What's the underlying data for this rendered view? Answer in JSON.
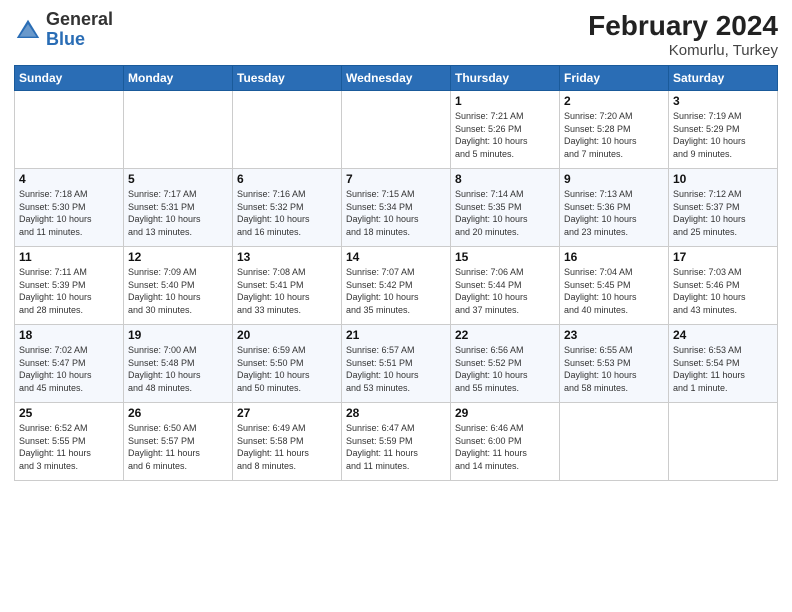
{
  "header": {
    "logo_general": "General",
    "logo_blue": "Blue",
    "title": "February 2024",
    "subtitle": "Komurlu, Turkey"
  },
  "days_of_week": [
    "Sunday",
    "Monday",
    "Tuesday",
    "Wednesday",
    "Thursday",
    "Friday",
    "Saturday"
  ],
  "weeks": [
    [
      {
        "day": "",
        "info": ""
      },
      {
        "day": "",
        "info": ""
      },
      {
        "day": "",
        "info": ""
      },
      {
        "day": "",
        "info": ""
      },
      {
        "day": "1",
        "info": "Sunrise: 7:21 AM\nSunset: 5:26 PM\nDaylight: 10 hours\nand 5 minutes."
      },
      {
        "day": "2",
        "info": "Sunrise: 7:20 AM\nSunset: 5:28 PM\nDaylight: 10 hours\nand 7 minutes."
      },
      {
        "day": "3",
        "info": "Sunrise: 7:19 AM\nSunset: 5:29 PM\nDaylight: 10 hours\nand 9 minutes."
      }
    ],
    [
      {
        "day": "4",
        "info": "Sunrise: 7:18 AM\nSunset: 5:30 PM\nDaylight: 10 hours\nand 11 minutes."
      },
      {
        "day": "5",
        "info": "Sunrise: 7:17 AM\nSunset: 5:31 PM\nDaylight: 10 hours\nand 13 minutes."
      },
      {
        "day": "6",
        "info": "Sunrise: 7:16 AM\nSunset: 5:32 PM\nDaylight: 10 hours\nand 16 minutes."
      },
      {
        "day": "7",
        "info": "Sunrise: 7:15 AM\nSunset: 5:34 PM\nDaylight: 10 hours\nand 18 minutes."
      },
      {
        "day": "8",
        "info": "Sunrise: 7:14 AM\nSunset: 5:35 PM\nDaylight: 10 hours\nand 20 minutes."
      },
      {
        "day": "9",
        "info": "Sunrise: 7:13 AM\nSunset: 5:36 PM\nDaylight: 10 hours\nand 23 minutes."
      },
      {
        "day": "10",
        "info": "Sunrise: 7:12 AM\nSunset: 5:37 PM\nDaylight: 10 hours\nand 25 minutes."
      }
    ],
    [
      {
        "day": "11",
        "info": "Sunrise: 7:11 AM\nSunset: 5:39 PM\nDaylight: 10 hours\nand 28 minutes."
      },
      {
        "day": "12",
        "info": "Sunrise: 7:09 AM\nSunset: 5:40 PM\nDaylight: 10 hours\nand 30 minutes."
      },
      {
        "day": "13",
        "info": "Sunrise: 7:08 AM\nSunset: 5:41 PM\nDaylight: 10 hours\nand 33 minutes."
      },
      {
        "day": "14",
        "info": "Sunrise: 7:07 AM\nSunset: 5:42 PM\nDaylight: 10 hours\nand 35 minutes."
      },
      {
        "day": "15",
        "info": "Sunrise: 7:06 AM\nSunset: 5:44 PM\nDaylight: 10 hours\nand 37 minutes."
      },
      {
        "day": "16",
        "info": "Sunrise: 7:04 AM\nSunset: 5:45 PM\nDaylight: 10 hours\nand 40 minutes."
      },
      {
        "day": "17",
        "info": "Sunrise: 7:03 AM\nSunset: 5:46 PM\nDaylight: 10 hours\nand 43 minutes."
      }
    ],
    [
      {
        "day": "18",
        "info": "Sunrise: 7:02 AM\nSunset: 5:47 PM\nDaylight: 10 hours\nand 45 minutes."
      },
      {
        "day": "19",
        "info": "Sunrise: 7:00 AM\nSunset: 5:48 PM\nDaylight: 10 hours\nand 48 minutes."
      },
      {
        "day": "20",
        "info": "Sunrise: 6:59 AM\nSunset: 5:50 PM\nDaylight: 10 hours\nand 50 minutes."
      },
      {
        "day": "21",
        "info": "Sunrise: 6:57 AM\nSunset: 5:51 PM\nDaylight: 10 hours\nand 53 minutes."
      },
      {
        "day": "22",
        "info": "Sunrise: 6:56 AM\nSunset: 5:52 PM\nDaylight: 10 hours\nand 55 minutes."
      },
      {
        "day": "23",
        "info": "Sunrise: 6:55 AM\nSunset: 5:53 PM\nDaylight: 10 hours\nand 58 minutes."
      },
      {
        "day": "24",
        "info": "Sunrise: 6:53 AM\nSunset: 5:54 PM\nDaylight: 11 hours\nand 1 minute."
      }
    ],
    [
      {
        "day": "25",
        "info": "Sunrise: 6:52 AM\nSunset: 5:55 PM\nDaylight: 11 hours\nand 3 minutes."
      },
      {
        "day": "26",
        "info": "Sunrise: 6:50 AM\nSunset: 5:57 PM\nDaylight: 11 hours\nand 6 minutes."
      },
      {
        "day": "27",
        "info": "Sunrise: 6:49 AM\nSunset: 5:58 PM\nDaylight: 11 hours\nand 8 minutes."
      },
      {
        "day": "28",
        "info": "Sunrise: 6:47 AM\nSunset: 5:59 PM\nDaylight: 11 hours\nand 11 minutes."
      },
      {
        "day": "29",
        "info": "Sunrise: 6:46 AM\nSunset: 6:00 PM\nDaylight: 11 hours\nand 14 minutes."
      },
      {
        "day": "",
        "info": ""
      },
      {
        "day": "",
        "info": ""
      }
    ]
  ]
}
